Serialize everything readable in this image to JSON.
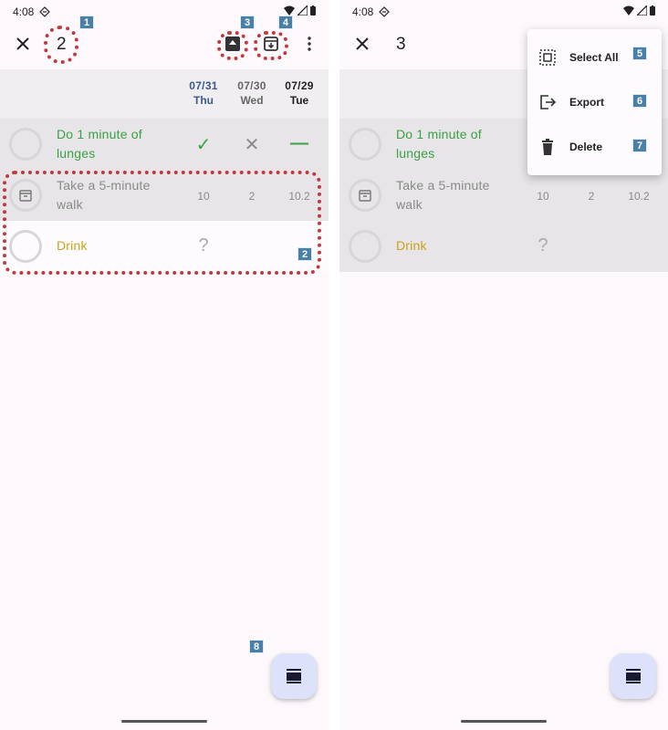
{
  "status": {
    "time": "4:08"
  },
  "left": {
    "selected_count": "2",
    "days": [
      {
        "date": "07/31",
        "weekday": "Thu"
      },
      {
        "date": "07/30",
        "weekday": "Wed"
      },
      {
        "date": "07/29",
        "weekday": "Tue"
      }
    ],
    "habits": [
      {
        "name": "Do 1 minute of lunges",
        "values": [
          "✓",
          "✕",
          "—"
        ]
      },
      {
        "name": "Take a 5-minute walk",
        "values": [
          "10",
          "2",
          "10.2"
        ]
      },
      {
        "name": "Drink",
        "values": [
          "?",
          "",
          ""
        ]
      }
    ],
    "annotations": [
      "1",
      "2",
      "3",
      "4",
      "8"
    ]
  },
  "right": {
    "selected_count": "3",
    "habits": [
      {
        "name": "Do 1 minute of lunges"
      },
      {
        "name": "Take a 5-minute walk",
        "values": [
          "10",
          "2",
          "10.2"
        ]
      },
      {
        "name": "Drink",
        "values": [
          "?"
        ]
      }
    ],
    "menu": [
      {
        "label": "Select All",
        "icon": "select-all-icon"
      },
      {
        "label": "Export",
        "icon": "export-icon"
      },
      {
        "label": "Delete",
        "icon": "delete-icon"
      }
    ],
    "annotations": [
      "5",
      "6",
      "7"
    ]
  },
  "colors": {
    "green": "#3aa145",
    "yellow": "#c9a31a",
    "gray_text": "#8a8a8a",
    "date_blue": "#3d5a8a",
    "selected_row": "#e7e5e7",
    "annot": "#4a7fa7",
    "dotted": "#c0393b"
  }
}
